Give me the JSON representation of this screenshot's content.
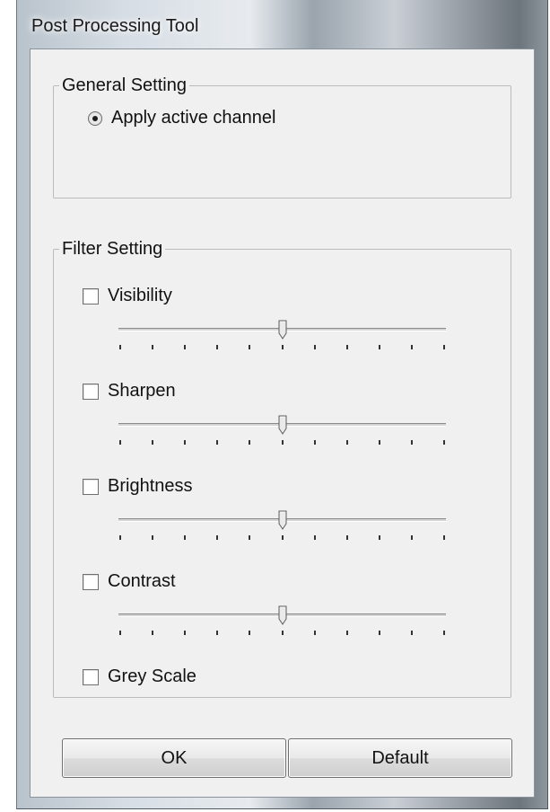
{
  "window": {
    "title": "Post Processing Tool"
  },
  "general": {
    "legend": "General Setting",
    "radio_label": "Apply active channel",
    "radio_selected": true
  },
  "filter": {
    "legend": "Filter Setting",
    "items": [
      {
        "label": "Visibility",
        "checked": false,
        "slider_value": 0.5
      },
      {
        "label": "Sharpen",
        "checked": false,
        "slider_value": 0.5
      },
      {
        "label": "Brightness",
        "checked": false,
        "slider_value": 0.5
      },
      {
        "label": "Contrast",
        "checked": false,
        "slider_value": 0.5
      }
    ],
    "grey_scale": {
      "label": "Grey Scale",
      "checked": false
    }
  },
  "buttons": {
    "ok": "OK",
    "default": "Default"
  }
}
